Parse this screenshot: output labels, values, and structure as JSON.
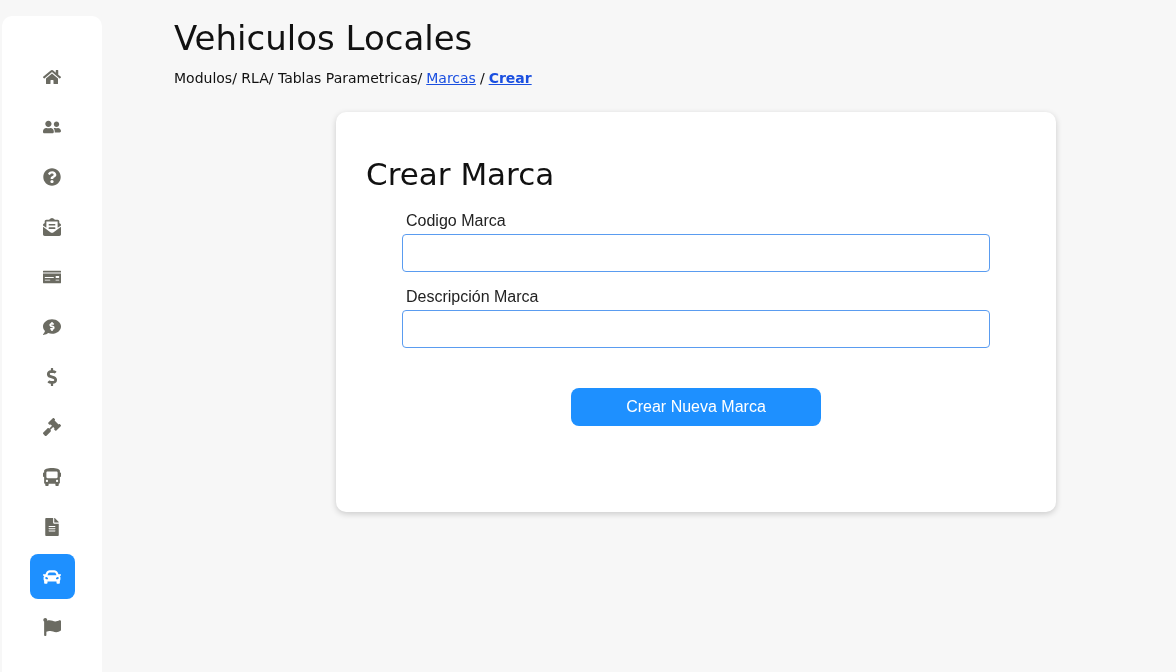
{
  "sidebar": {
    "items": [
      {
        "kind": "home",
        "selected": false
      },
      {
        "kind": "users",
        "selected": false
      },
      {
        "kind": "question",
        "selected": false
      },
      {
        "kind": "envelope",
        "selected": false
      },
      {
        "kind": "money-check",
        "selected": false
      },
      {
        "kind": "comment-dollar",
        "selected": false
      },
      {
        "kind": "dollar",
        "selected": false
      },
      {
        "kind": "gavel",
        "selected": false
      },
      {
        "kind": "bus",
        "selected": false
      },
      {
        "kind": "file",
        "selected": false
      },
      {
        "kind": "car",
        "selected": true
      },
      {
        "kind": "flag",
        "selected": false
      }
    ]
  },
  "page": {
    "title": "Vehiculos Locales",
    "breadcrumbs": [
      {
        "label": "Modulos/ RLA/ Tablas Parametricas/",
        "kind": "text"
      },
      {
        "label": "Marcas",
        "kind": "link"
      },
      {
        "label": "/",
        "kind": "text"
      },
      {
        "label": "Crear",
        "kind": "current"
      }
    ]
  },
  "form": {
    "title": "Crear Marca",
    "fields": [
      {
        "label": "Codigo Marca"
      },
      {
        "label": "Descripción Marca"
      }
    ],
    "submit": "Crear Nueva Marca"
  }
}
